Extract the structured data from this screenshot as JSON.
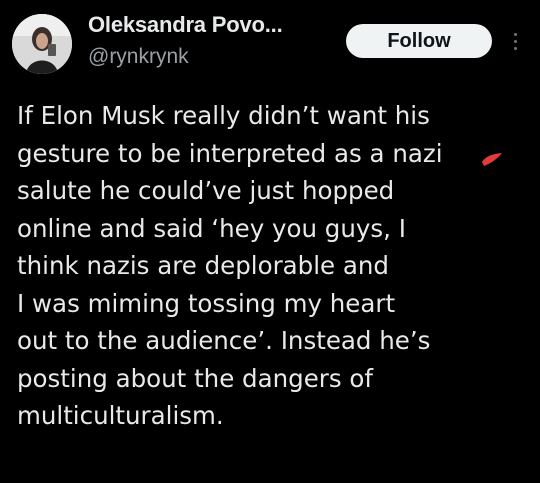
{
  "profile": {
    "display_name": "Oleksandra Povo...",
    "handle": "@rynkrynk",
    "avatar": "profile-photo"
  },
  "actions": {
    "follow_label": "Follow",
    "more_icon": "vertical-ellipsis-icon"
  },
  "post": {
    "lines": [
      "If Elon Musk really didn’t want his",
      "gesture to be interpreted as a nazi",
      "salute he could’ve just hopped",
      "online and said ‘hey you guys, I",
      "think nazis are deplorable and",
      "I was miming tossing my heart",
      "out to the audience’. Instead he’s",
      "posting about the dangers of",
      "multiculturalism."
    ]
  },
  "colors": {
    "background": "#000000",
    "text": "#e7e9ea",
    "secondary_text": "#9aa0a6",
    "follow_bg": "#eff3f4",
    "blot": "#e23b3b"
  }
}
